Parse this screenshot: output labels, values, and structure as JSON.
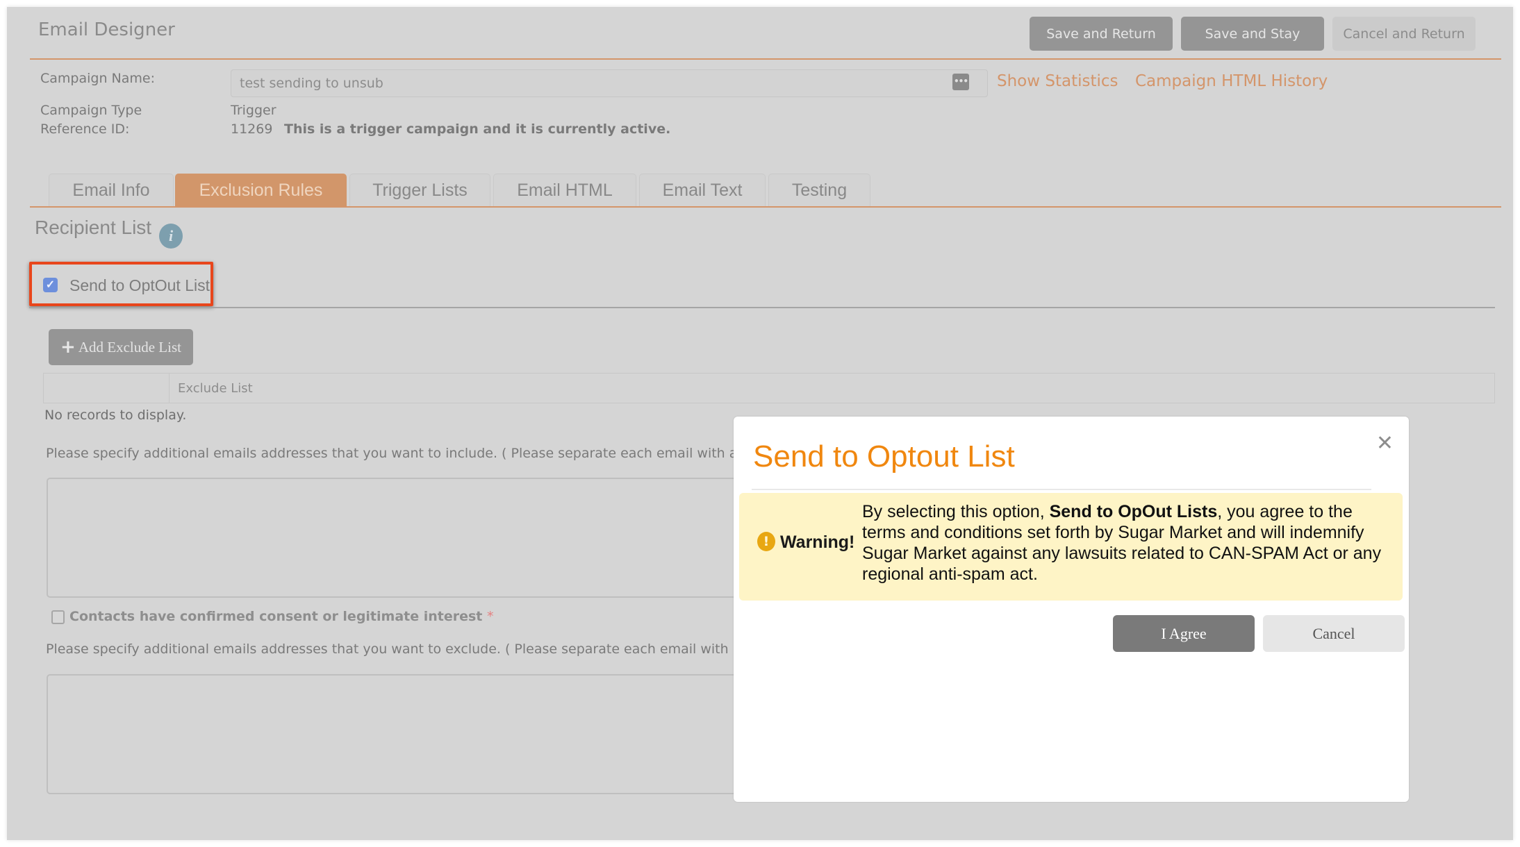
{
  "header": {
    "title": "Email Designer",
    "buttons": {
      "save_return": "Save and Return",
      "save_stay": "Save and Stay",
      "cancel_return": "Cancel and Return"
    }
  },
  "campaign": {
    "name_label": "Campaign Name:",
    "name_value": "test sending to unsub",
    "type_label": "Campaign Type",
    "type_value": "Trigger",
    "ref_label": "Reference ID:",
    "ref_value": "11269",
    "status_text": "This is a trigger campaign and it is currently active.",
    "links": {
      "show_statistics": "Show Statistics",
      "html_history": "Campaign HTML History"
    },
    "input_icon": "dots-icon",
    "input_icon_glyph": "•••"
  },
  "tabs": [
    {
      "label": "Email Info",
      "active": false
    },
    {
      "label": "Exclusion Rules",
      "active": true
    },
    {
      "label": "Trigger Lists",
      "active": false
    },
    {
      "label": "Email HTML",
      "active": false
    },
    {
      "label": "Email Text",
      "active": false
    },
    {
      "label": "Testing",
      "active": false
    }
  ],
  "recipient": {
    "section_title": "Recipient List",
    "info_glyph": "i",
    "optout_label": "Send to OptOut List",
    "optout_checked": true,
    "check_glyph": "✓",
    "add_exclude_label": "Add Exclude List",
    "plus_glyph": "+",
    "grid": {
      "columns": [
        "",
        "Exclude List"
      ],
      "empty_text": "No records to display."
    },
    "include_hint": "Please specify additional emails addresses that you want to include. ( Please separate each email with a",
    "include_value": "",
    "consent_label": "Contacts have confirmed consent or legitimate interest",
    "consent_required": "*",
    "consent_checked": false,
    "exclude_hint": "Please specify additional emails addresses that you want to exclude. ( Please separate each email with",
    "exclude_value": ""
  },
  "modal": {
    "title": "Send to Optout List",
    "close_glyph": "✕",
    "warning_glyph": "!",
    "warning_title": "Warning!",
    "warning_pre": "By selecting this option, ",
    "warning_bold": "Send to OpOut Lists",
    "warning_post": ", you agree to the terms and conditions set forth by Sugar Market and will indemnify Sugar Market against any lawsuits related to CAN-SPAM Act or any regional anti-spam act.",
    "agree_label": "I Agree",
    "cancel_label": "Cancel"
  },
  "colors": {
    "accent_orange": "#d4956a",
    "modal_title_orange": "#f0870f",
    "highlight_red": "#e8461c",
    "warning_bg": "#fef4c6",
    "warning_icon": "#e8a712"
  }
}
